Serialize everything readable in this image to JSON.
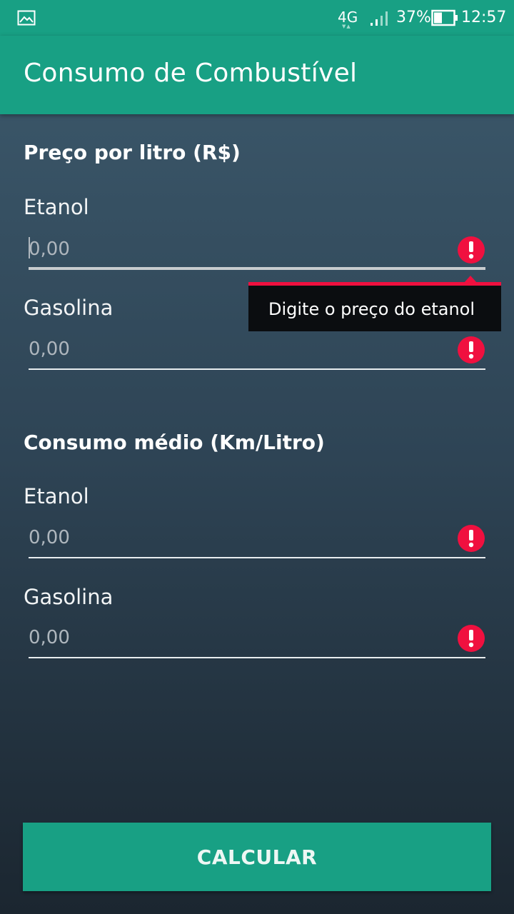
{
  "status_bar": {
    "network": "4G",
    "battery": "37%",
    "time": "12:57",
    "icons": [
      "gallery-icon",
      "signal-icon",
      "battery-icon"
    ]
  },
  "app_bar": {
    "title": "Consumo de Combustível"
  },
  "preco": {
    "title": "Preço por litro (R$)",
    "etanol": {
      "label": "Etanol",
      "placeholder": "0,00",
      "error": true
    },
    "gasolina": {
      "label": "Gasolina",
      "placeholder": "0,00",
      "error": true
    }
  },
  "consumo": {
    "title": "Consumo médio (Km/Litro)",
    "etanol": {
      "label": "Etanol",
      "placeholder": "0,00",
      "error": true
    },
    "gasolina": {
      "label": "Gasolina",
      "placeholder": "0,00",
      "error": true
    }
  },
  "error_tooltip": {
    "text": "Digite o preço do etanol"
  },
  "calculate_button": {
    "label": "CALCULAR"
  },
  "colors": {
    "primary": "#18a084",
    "error": "#f0103f",
    "background_top": "#3d5a6d",
    "background_bottom": "#1b2630"
  }
}
